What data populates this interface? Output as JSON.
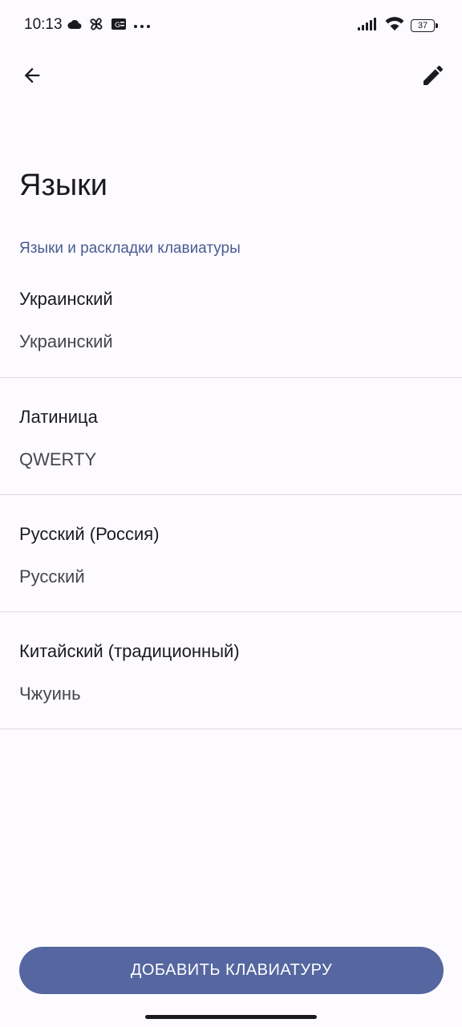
{
  "status_bar": {
    "time": "10:13",
    "battery_level": "37",
    "left_icons": [
      "cloud-icon",
      "pinwheel-icon",
      "g-translate-badge-icon",
      "more-dots-icon"
    ],
    "right_icons": [
      "signal-icon",
      "wifi-icon",
      "battery-icon"
    ]
  },
  "toolbar": {
    "back_icon": "arrow-back-icon",
    "edit_icon": "pencil-icon"
  },
  "page": {
    "title": "Языки",
    "section_header": "Языки и раскладки клавиатуры"
  },
  "languages": [
    {
      "name": "Украинский",
      "layout": "Украинский"
    },
    {
      "name": "Латиница",
      "layout": "QWERTY"
    },
    {
      "name": "Русский (Россия)",
      "layout": "Русский"
    },
    {
      "name": "Китайский (традиционный)",
      "layout": "Чжуинь"
    }
  ],
  "actions": {
    "add_keyboard_label": "ДОБАВИТЬ КЛАВИАТУРУ"
  },
  "colors": {
    "accent": "#5566a0",
    "section_header": "#4a5b92",
    "background": "#fdfbff"
  }
}
